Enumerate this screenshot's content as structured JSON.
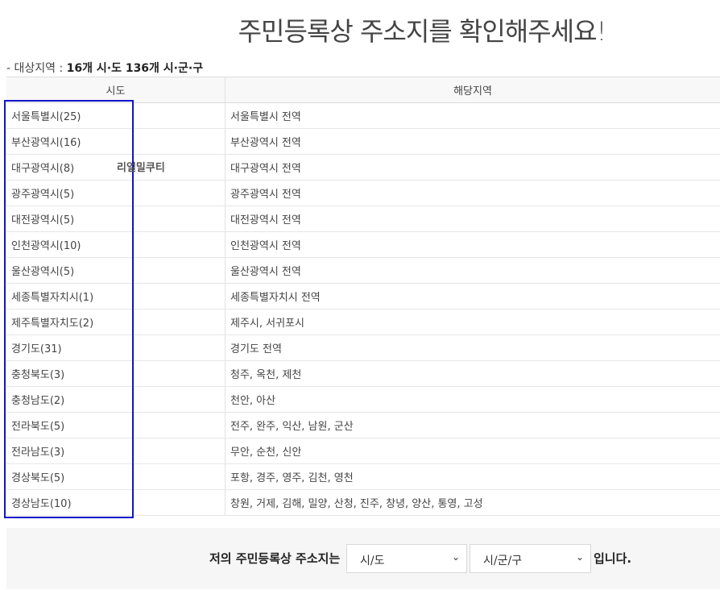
{
  "headline": "주민등록상 주소지를 확인해주세요!",
  "subtitle": {
    "prefix": "- 대상지역 : ",
    "value": "16개 시·도 136개 시·군·구"
  },
  "table": {
    "headers": [
      "시도",
      "해당지역"
    ],
    "rows": [
      {
        "sido": "서울특별시(25)",
        "area": "서울특별시 전역"
      },
      {
        "sido": "부산광역시(16)",
        "area": "부산광역시 전역"
      },
      {
        "sido": "대구광역시(8)",
        "area": "대구광역시 전역"
      },
      {
        "sido": "광주광역시(5)",
        "area": "광주광역시 전역"
      },
      {
        "sido": "대전광역시(5)",
        "area": "대전광역시 전역"
      },
      {
        "sido": "인천광역시(10)",
        "area": "인천광역시 전역"
      },
      {
        "sido": "울산광역시(5)",
        "area": "울산광역시 전역"
      },
      {
        "sido": "세종특별자치시(1)",
        "area": "세종특별자치시 전역"
      },
      {
        "sido": "제주특별자치도(2)",
        "area": "제주시, 서귀포시"
      },
      {
        "sido": "경기도(31)",
        "area": "경기도 전역"
      },
      {
        "sido": "충청북도(3)",
        "area": "청주, 옥천, 제천"
      },
      {
        "sido": "충청남도(2)",
        "area": "천안, 아산"
      },
      {
        "sido": "전라북도(5)",
        "area": "전주, 완주, 익산, 남원, 군산"
      },
      {
        "sido": "전라남도(3)",
        "area": "무안, 순천, 신안"
      },
      {
        "sido": "경상북도(5)",
        "area": "포항, 경주, 영주, 김천, 영천"
      },
      {
        "sido": "경상남도(10)",
        "area": "창원, 거제, 김해, 밀양, 산청, 진주, 창녕, 양산, 통영, 고성"
      }
    ]
  },
  "watermark": "리얼밀쿠티",
  "form": {
    "label": "저의 주민등록상 주소지는",
    "sido_select": "시/도",
    "sigungu_select": "시/군/구",
    "suffix": "입니다."
  },
  "colors": {
    "highlight_border": "#1212c8",
    "header_bg": "#f8f8f8",
    "form_bg": "#f6f6f6"
  }
}
